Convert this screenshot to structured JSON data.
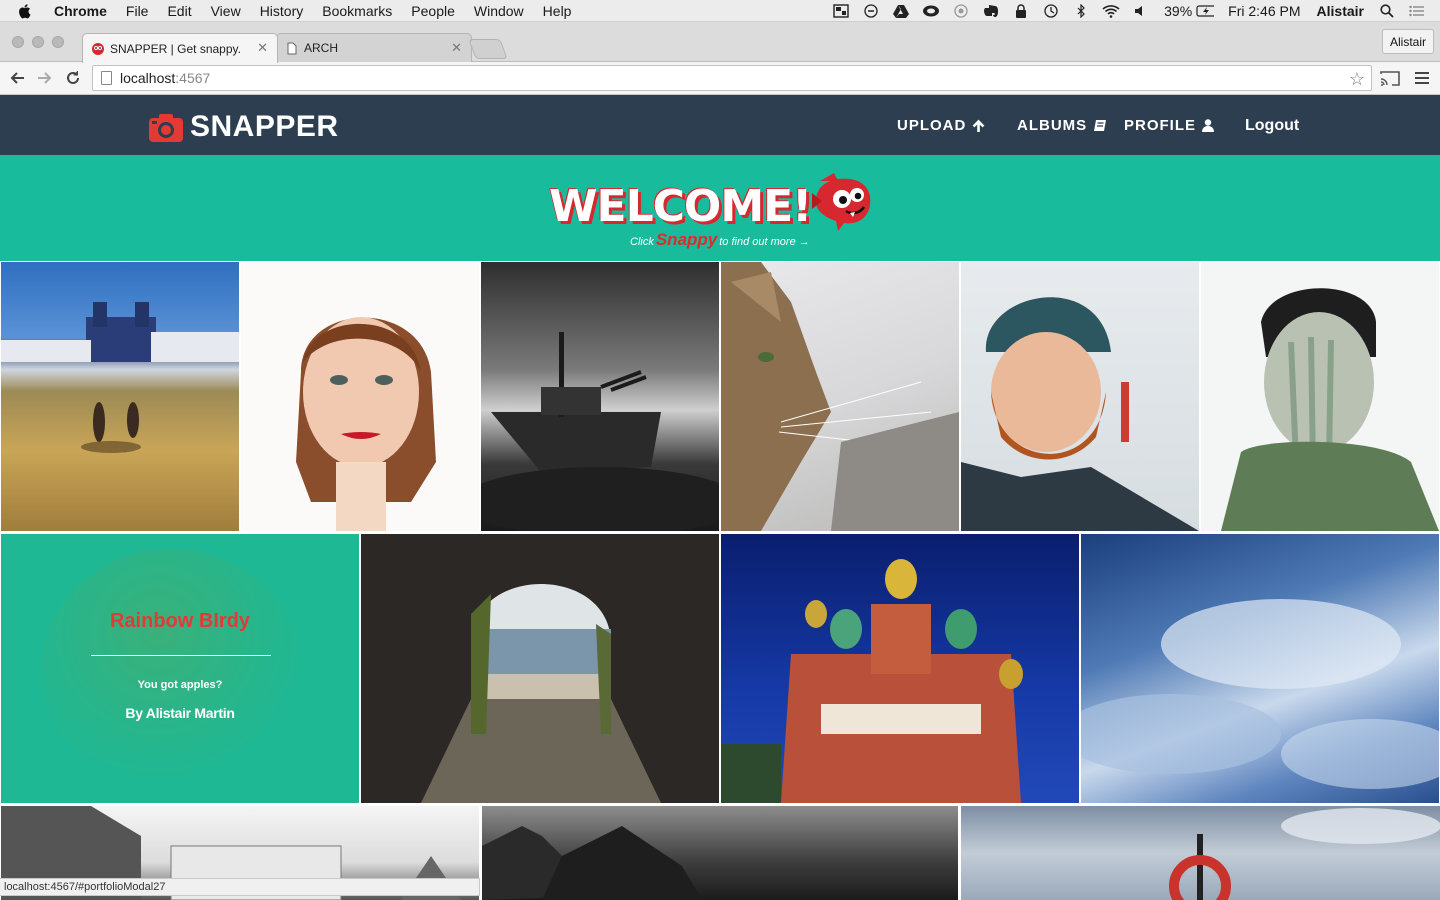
{
  "menubar": {
    "app_name": "Chrome",
    "items": [
      "File",
      "Edit",
      "View",
      "History",
      "Bookmarks",
      "People",
      "Window",
      "Help"
    ],
    "battery": "39%",
    "clock": "Fri 2:46 PM",
    "user": "Alistair"
  },
  "browser": {
    "tabs": [
      {
        "title": "SNAPPER | Get snappy.",
        "favicon": "snapper-favicon"
      },
      {
        "title": "ARCH",
        "favicon": "page-icon"
      }
    ],
    "profile_button": "Alistair",
    "url_host": "localhost",
    "url_port": ":4567",
    "status_url": "localhost:4567/#portfolioModal27"
  },
  "site": {
    "brand": "SNAPPER",
    "nav": {
      "upload": "UPLOAD",
      "albums": "ALBUMS",
      "profile": "PROFILE",
      "logout": "Logout"
    },
    "banner": {
      "headline": "WELCOME!",
      "sub_before": "Click",
      "sub_brand": "Snappy",
      "sub_after": "to find out more →"
    },
    "featured": {
      "title": "Rainbow BIrdy",
      "description": "You got apples?",
      "author": "By Alistair Martin"
    },
    "photos": [
      "monastery-square-photo",
      "woman-portrait-photo",
      "shipwreck-photo",
      "cat-profile-photo",
      "bearded-man-beanie-photo",
      "man-portrait-double-exposure-photo",
      "tunnel-to-beach-photo",
      "saint-petersburg-cathedral-photo",
      "ocean-spray-photo",
      "bw-building-photo",
      "bw-rocks-photo",
      "lifebuoy-sky-photo"
    ]
  },
  "colors": {
    "nav_bg": "#2c3e50",
    "banner_bg": "#18bc9c",
    "accent_red": "#e53935"
  }
}
